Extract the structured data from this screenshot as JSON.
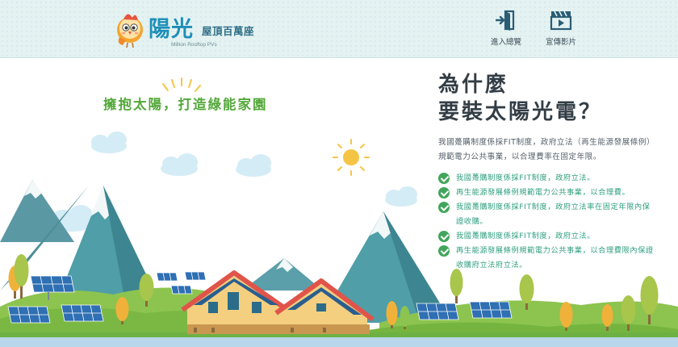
{
  "header": {
    "logo": {
      "main": "陽光",
      "sub": "屋頂百萬座",
      "tagline": "Million Rooftop PVs"
    },
    "nav": [
      {
        "label": "進入總覽",
        "icon": "enter-door-icon"
      },
      {
        "label": "宣傳影片",
        "icon": "video-clapper-icon"
      }
    ]
  },
  "hero": {
    "slogan": "擁抱太陽，打造綠能家園"
  },
  "content": {
    "title_line1": "為什麼",
    "title_line2": "要裝太陽光電？",
    "intro": "我國躉購制度係採FIT制度，政府立法（再生能源發展條例）規範電力公共事業，以合理費率在固定年限。",
    "points": [
      "我國躉購制度係採FIT制度，政府立法。",
      "再生能源發展條例規範電力公共事業，以合理費。",
      "我國躉購制度係採FIT制度，政府立法率在固定年限內保證收購。",
      "我國躉購制度係採FIT制度，政府立法。",
      "再生能源發展條例規範電力公共事業，以合理費限內保證收購府立法府立法。"
    ]
  },
  "colors": {
    "header_bg": "#e4f2f2",
    "brand_blue": "#1f8fb8",
    "slogan_green": "#53a83a",
    "check_green": "#41a65b",
    "point_text": "#2fa07e",
    "mountain_teal": "#4f9ea8",
    "sun_yellow": "#f6c445",
    "roof_red": "#e0544a"
  }
}
